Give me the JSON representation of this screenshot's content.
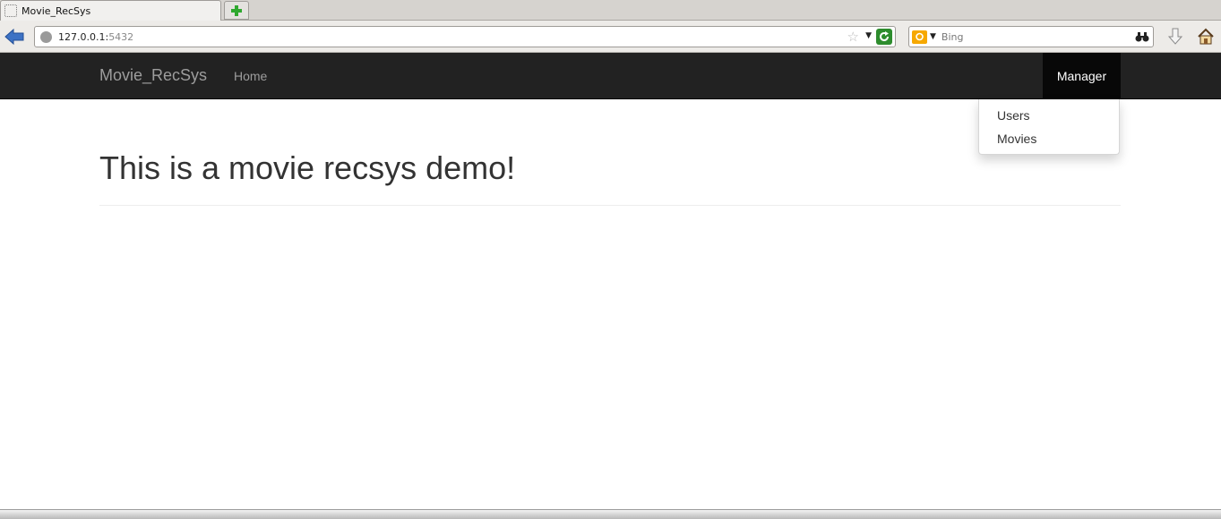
{
  "browser": {
    "tab_title": "Movie_RecSys",
    "url_host": "127.0.0.1:",
    "url_port": "5432",
    "search_engine": "Bing",
    "search_placeholder": "Bing"
  },
  "navbar": {
    "brand": "Movie_RecSys",
    "home_label": "Home",
    "manager_label": "Manager",
    "bg_color": "#222222"
  },
  "dropdown": {
    "items": [
      {
        "label": "Users"
      },
      {
        "label": "Movies"
      }
    ]
  },
  "main": {
    "headline": "This is a movie recsys demo!"
  }
}
